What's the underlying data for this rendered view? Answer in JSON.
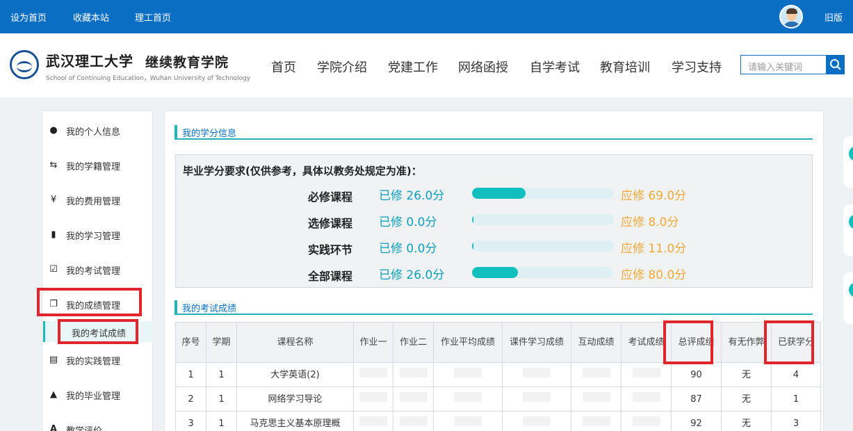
{
  "topbar": {
    "links": [
      "设为首页",
      "收藏本站",
      "理工首页"
    ],
    "old_version": "旧版"
  },
  "header": {
    "school_name": "武汉理工大学",
    "college_name": "继续教育学院",
    "english_name": "School of Continuing Education，Wuhan University of Technology",
    "nav": [
      "首页",
      "学院介绍",
      "党建工作",
      "网络函授",
      "自学考试",
      "教育培训",
      "学习支持"
    ],
    "search_placeholder": "请输入关键词"
  },
  "sidebar": {
    "items": [
      {
        "label": "我的个人信息",
        "icon": "user-icon"
      },
      {
        "label": "我的学籍管理",
        "icon": "exchange-icon"
      },
      {
        "label": "我的费用管理",
        "icon": "yen-icon"
      },
      {
        "label": "我的学习管理",
        "icon": "book-icon"
      },
      {
        "label": "我的考试管理",
        "icon": "edit-icon"
      },
      {
        "label": "我的成绩管理",
        "icon": "copy-icon"
      },
      {
        "label": "我的实践管理",
        "icon": "id-card-icon"
      },
      {
        "label": "我的毕业管理",
        "icon": "graduation-cap-icon"
      },
      {
        "label": "教学评价",
        "icon": "font-icon"
      }
    ],
    "sub_item": "我的考试成绩"
  },
  "credits": {
    "section_title": "我的学分信息",
    "heading": "毕业学分要求(仅供参考，具体以教务处规定为准)：",
    "rows": [
      {
        "name": "必修课程",
        "done": "已修 26.0分",
        "need": "应修 69.0分",
        "progress": 0.377
      },
      {
        "name": "选修课程",
        "done": "已修 0.0分",
        "need": "应修 8.0分",
        "progress": 0.0
      },
      {
        "name": "实践环节",
        "done": "已修 0.0分",
        "need": "应修 11.0分",
        "progress": 0.0
      },
      {
        "name": "全部课程",
        "done": "已修 26.0分",
        "need": "应修 80.0分",
        "progress": 0.325
      }
    ]
  },
  "scores": {
    "section_title": "我的考试成绩",
    "headers": [
      "序号",
      "学期",
      "课程名称",
      "作业一",
      "作业二",
      "作业平均成绩",
      "课件学习成绩",
      "互动成绩",
      "考试成绩",
      "总评成绩",
      "有无作弊",
      "已获学分"
    ],
    "rows": [
      {
        "no": "1",
        "term": "1",
        "course": "大学英语(2)",
        "total": "90",
        "cheat": "无",
        "credit": "4"
      },
      {
        "no": "2",
        "term": "1",
        "course": "网络学习导论",
        "total": "87",
        "cheat": "无",
        "credit": "1"
      },
      {
        "no": "3",
        "term": "1",
        "course": "马克思主义基本原理概",
        "total": "92",
        "cheat": "无",
        "credit": "3"
      }
    ]
  },
  "colors": {
    "primary_blue": "#0a6fc2",
    "teal": "#12bfbf",
    "orange": "#f0a93a",
    "highlight_red": "#e2242c"
  }
}
